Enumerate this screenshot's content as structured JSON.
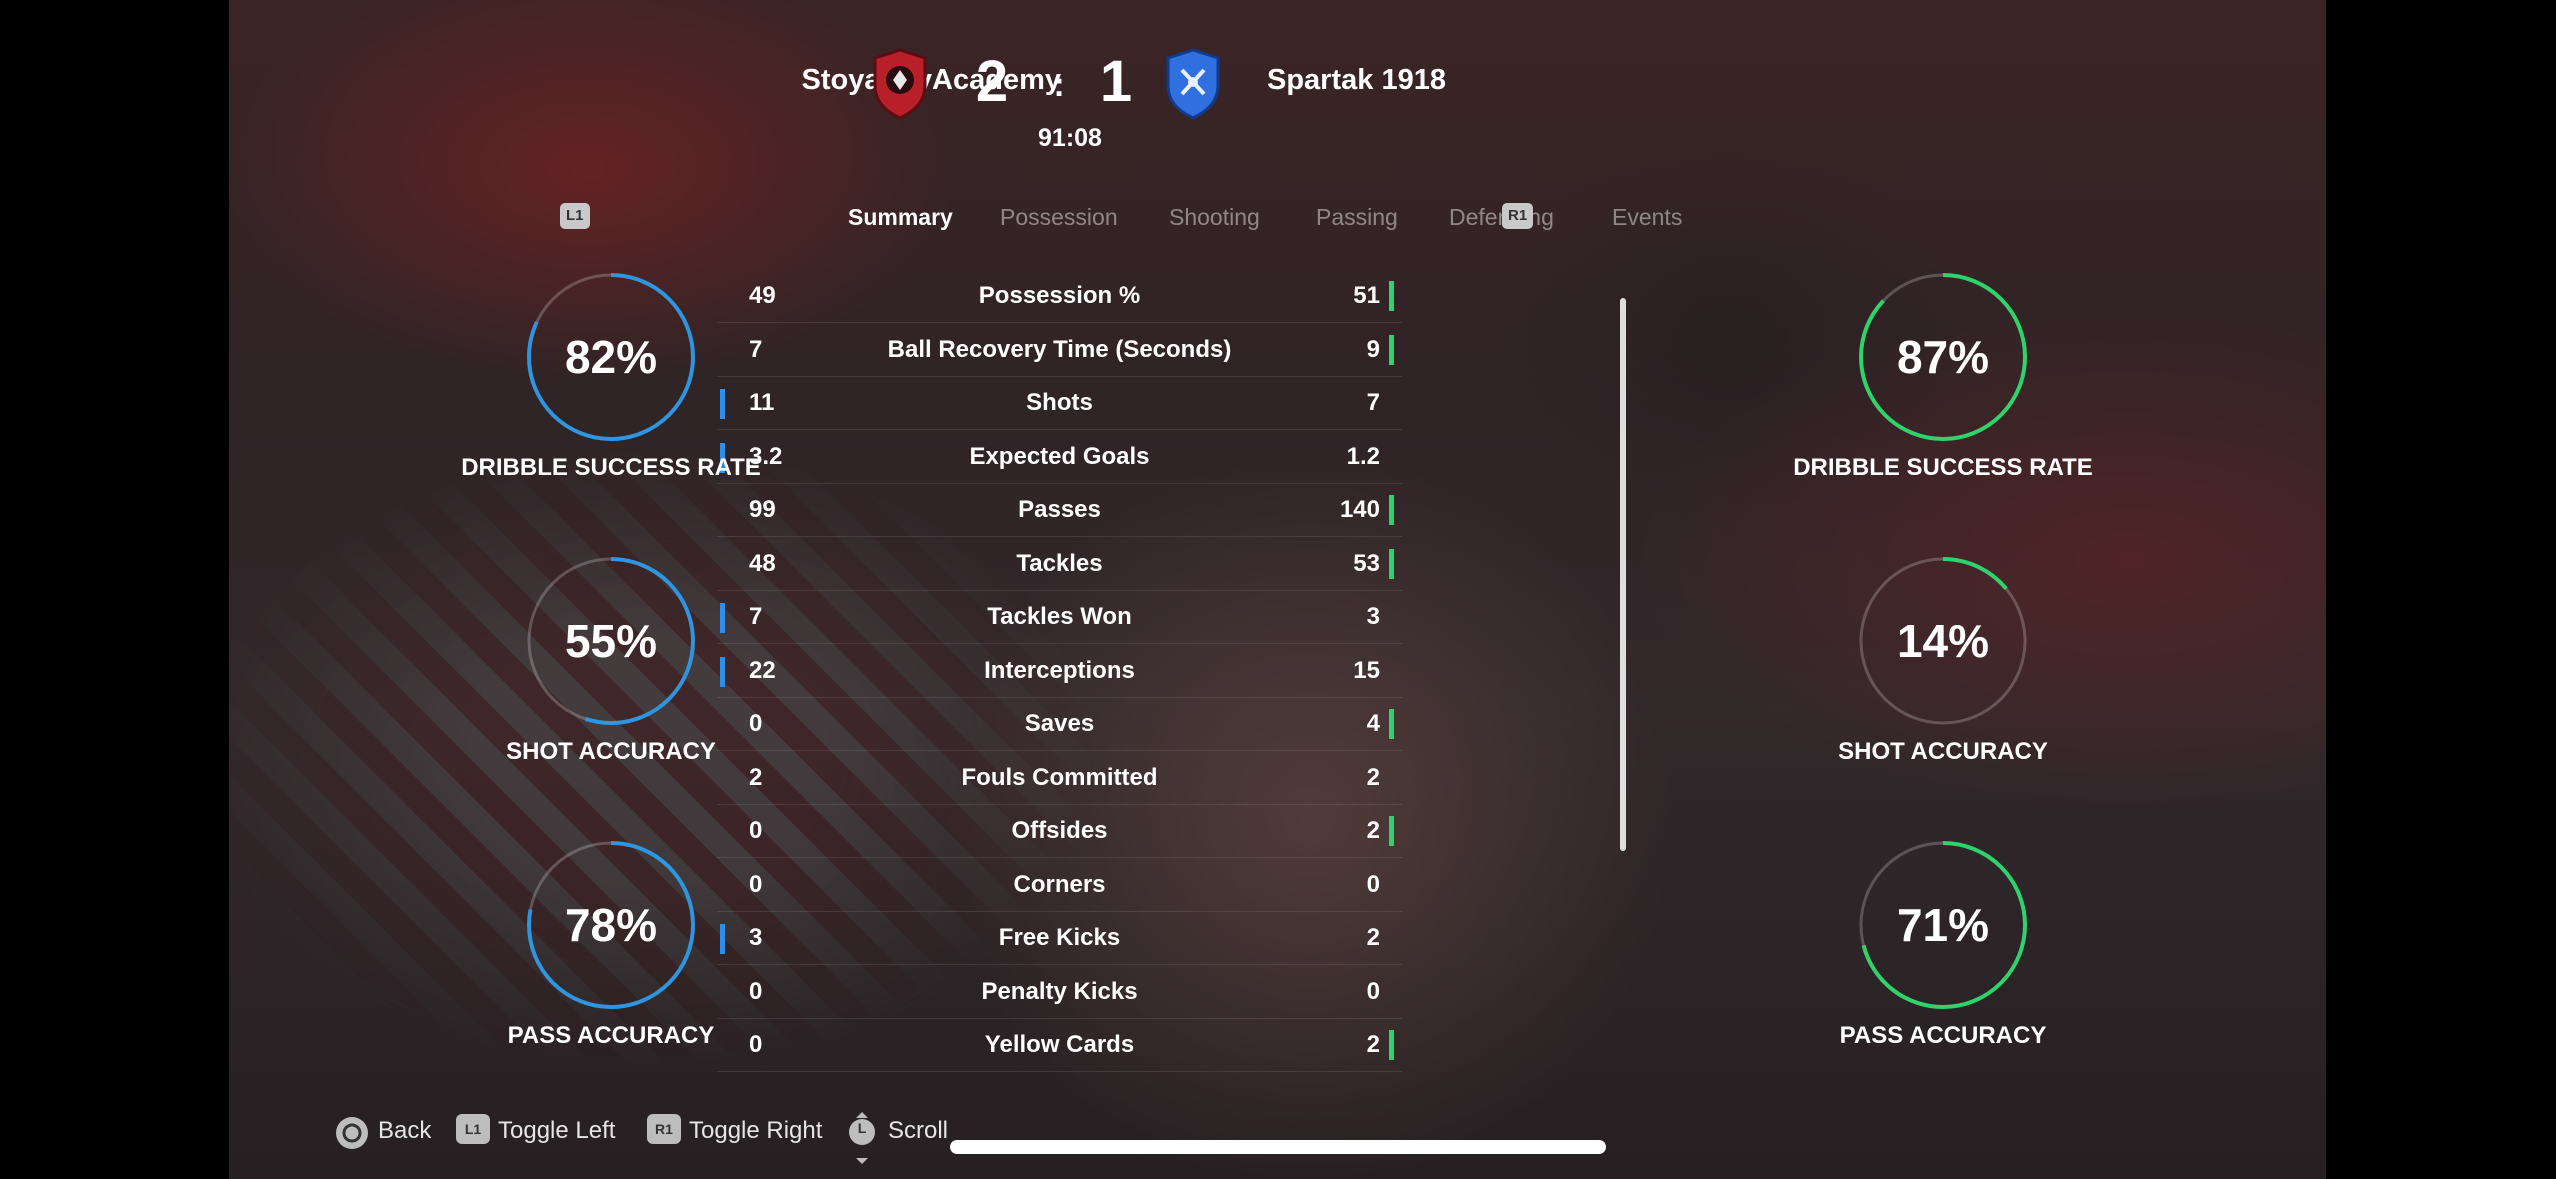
{
  "match": {
    "home_team": "StoyanovAcademy",
    "away_team": "Spartak 1918",
    "home_score": "2",
    "score_separator": ":",
    "away_score": "1",
    "clock": "91:08",
    "home_color": "#c8202a",
    "away_color": "#2f6fe0"
  },
  "tabs": {
    "left_button": "L1",
    "right_button": "R1",
    "items": [
      "Summary",
      "Possession",
      "Shooting",
      "Passing",
      "Defending",
      "Events"
    ],
    "active": "Summary"
  },
  "stats": [
    {
      "label": "Possession %",
      "home": "49",
      "away": "51",
      "leader": "away"
    },
    {
      "label": "Ball Recovery Time (Seconds)",
      "home": "7",
      "away": "9",
      "leader": "away"
    },
    {
      "label": "Shots",
      "home": "11",
      "away": "7",
      "leader": "home"
    },
    {
      "label": "Expected Goals",
      "home": "3.2",
      "away": "1.2",
      "leader": "home"
    },
    {
      "label": "Passes",
      "home": "99",
      "away": "140",
      "leader": "away"
    },
    {
      "label": "Tackles",
      "home": "48",
      "away": "53",
      "leader": "away"
    },
    {
      "label": "Tackles Won",
      "home": "7",
      "away": "3",
      "leader": "home"
    },
    {
      "label": "Interceptions",
      "home": "22",
      "away": "15",
      "leader": "home"
    },
    {
      "label": "Saves",
      "home": "0",
      "away": "4",
      "leader": "away"
    },
    {
      "label": "Fouls Committed",
      "home": "2",
      "away": "2",
      "leader": "none"
    },
    {
      "label": "Offsides",
      "home": "0",
      "away": "2",
      "leader": "away"
    },
    {
      "label": "Corners",
      "home": "0",
      "away": "0",
      "leader": "none"
    },
    {
      "label": "Free Kicks",
      "home": "3",
      "away": "2",
      "leader": "home"
    },
    {
      "label": "Penalty Kicks",
      "home": "0",
      "away": "0",
      "leader": "none"
    },
    {
      "label": "Yellow Cards",
      "home": "0",
      "away": "2",
      "leader": "away"
    }
  ],
  "gauges": {
    "home": [
      {
        "label": "DRIBBLE SUCCESS RATE",
        "value": "82%",
        "fraction": 0.82
      },
      {
        "label": "SHOT ACCURACY",
        "value": "55%",
        "fraction": 0.55
      },
      {
        "label": "PASS ACCURACY",
        "value": "78%",
        "fraction": 0.78
      }
    ],
    "away": [
      {
        "label": "DRIBBLE SUCCESS RATE",
        "value": "87%",
        "fraction": 0.87
      },
      {
        "label": "SHOT ACCURACY",
        "value": "14%",
        "fraction": 0.14
      },
      {
        "label": "PASS ACCURACY",
        "value": "71%",
        "fraction": 0.71
      }
    ],
    "home_color": "#2f95df",
    "away_color": "#2fd36b"
  },
  "footer": {
    "back_icon": "circle-button-icon",
    "back_label": "Back",
    "toggle_left_button": "L1",
    "toggle_left_label": "Toggle Left",
    "toggle_right_button": "R1",
    "toggle_right_label": "Toggle Right",
    "scroll_button": "L",
    "scroll_label": "Scroll"
  }
}
